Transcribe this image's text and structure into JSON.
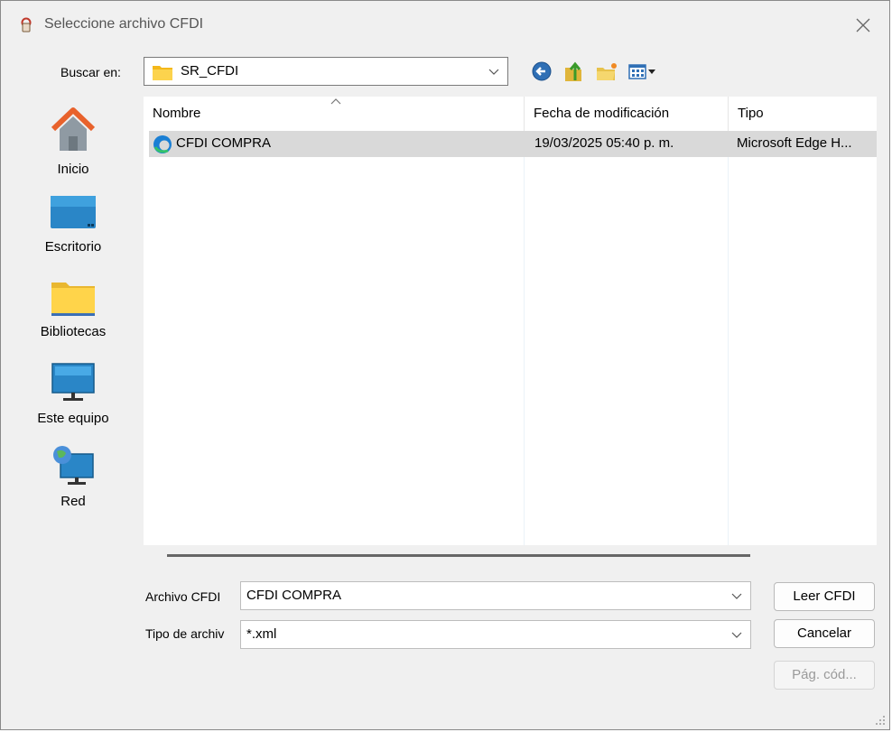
{
  "window": {
    "title": "Seleccione archivo CFDI"
  },
  "lookin": {
    "label": "Buscar en:",
    "value": "SR_CFDI"
  },
  "toolbar": {
    "icons": [
      "back-icon",
      "up-folder-icon",
      "new-folder-icon",
      "view-menu-icon"
    ]
  },
  "places": [
    {
      "label": "Inicio",
      "icon": "home-icon"
    },
    {
      "label": "Escritorio",
      "icon": "desktop-icon"
    },
    {
      "label": "Bibliotecas",
      "icon": "libraries-icon"
    },
    {
      "label": "Este equipo",
      "icon": "this-pc-icon"
    },
    {
      "label": "Red",
      "icon": "network-icon"
    }
  ],
  "list": {
    "columns": [
      "Nombre",
      "Fecha de modificación",
      "Tipo"
    ],
    "rows": [
      {
        "name": "CFDI COMPRA",
        "date": "19/03/2025 05:40 p. m.",
        "type": "Microsoft Edge H..."
      }
    ]
  },
  "fields": {
    "filename_label": "Archivo CFDI",
    "filename_value": "CFDI COMPRA",
    "filetype_label": "Tipo de archiv",
    "filetype_value": "*.xml"
  },
  "buttons": {
    "open": "Leer CFDI",
    "cancel": "Cancelar",
    "codepage": "Pág. cód..."
  }
}
